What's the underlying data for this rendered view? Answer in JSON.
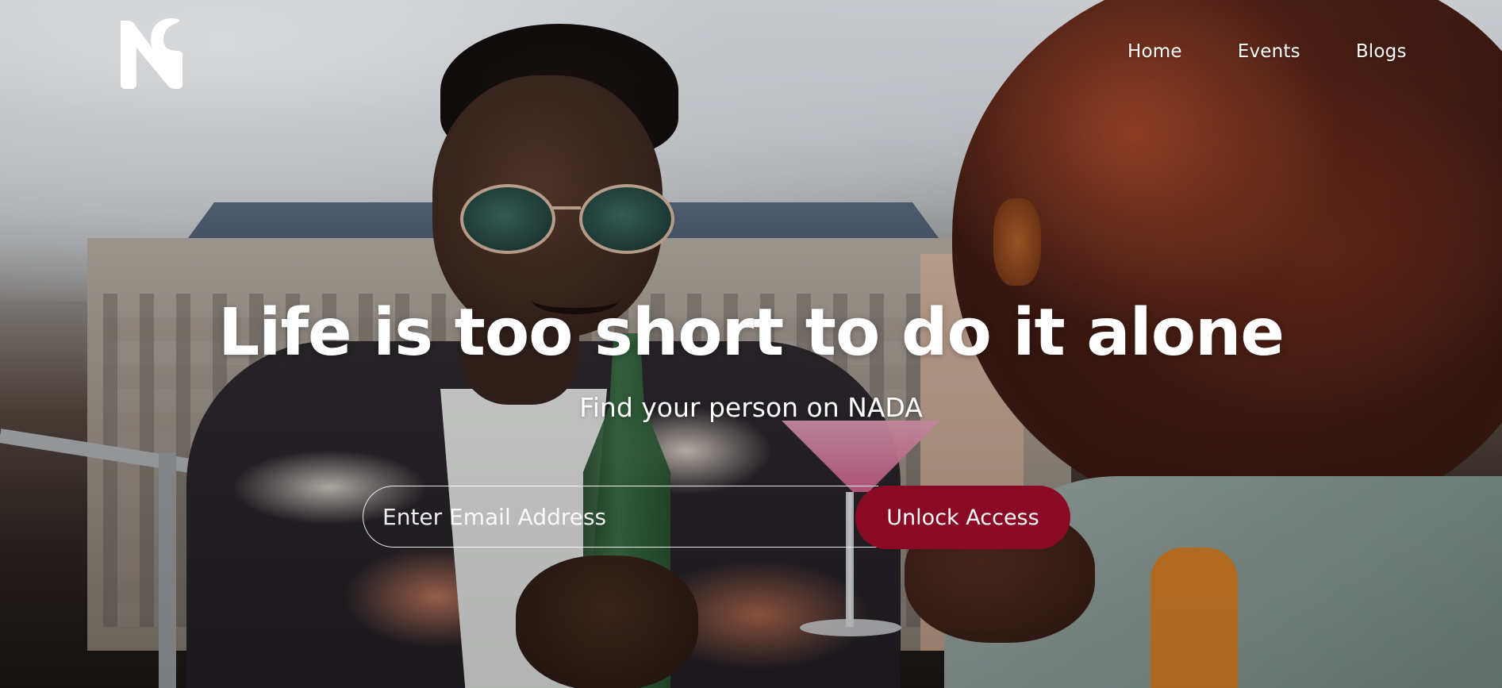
{
  "brand": {
    "logo_icon": "nada-n-logo-icon",
    "logo_color": "#ffffff"
  },
  "nav": {
    "items": [
      {
        "label": "Home"
      },
      {
        "label": "Events"
      },
      {
        "label": "Blogs"
      }
    ]
  },
  "hero": {
    "headline": "Life is too short to do it alone",
    "subheadline": "Find your person on NADA",
    "background_image": "rooftop-party-photo"
  },
  "signup": {
    "email_placeholder": "Enter Email Address",
    "email_value": "",
    "submit_label": "Unlock Access",
    "accent_color": "#8a0a26"
  }
}
